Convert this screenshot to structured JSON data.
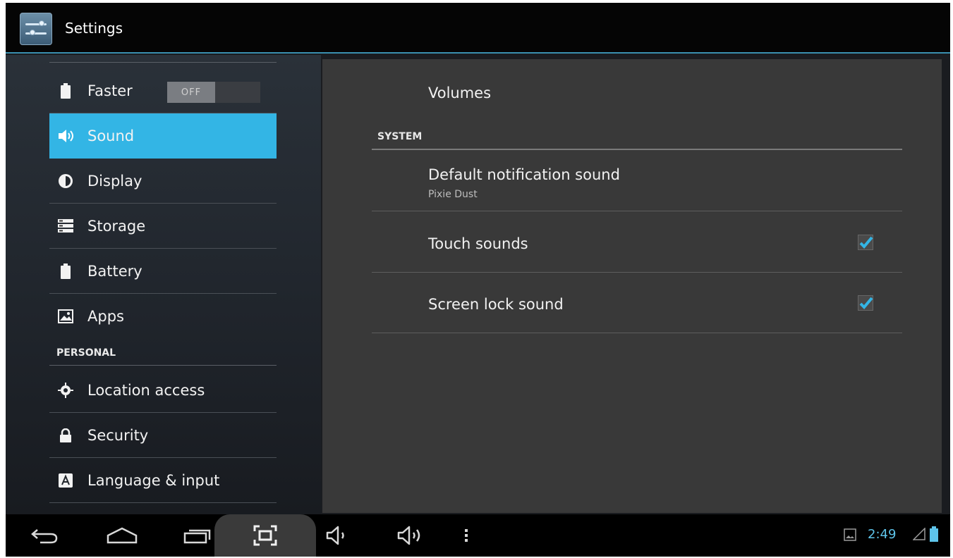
{
  "action_bar": {
    "title": "Settings",
    "icon": "settings-sliders-icon"
  },
  "sidebar": {
    "items": [
      {
        "id": "faster",
        "label": "Faster",
        "icon": "battery-icon",
        "toggle": "OFF"
      },
      {
        "id": "sound",
        "label": "Sound",
        "icon": "speaker-icon",
        "active": true
      },
      {
        "id": "display",
        "label": "Display",
        "icon": "brightness-icon"
      },
      {
        "id": "storage",
        "label": "Storage",
        "icon": "storage-icon"
      },
      {
        "id": "battery",
        "label": "Battery",
        "icon": "battery-icon"
      },
      {
        "id": "apps",
        "label": "Apps",
        "icon": "apps-icon"
      }
    ],
    "personal_header": "PERSONAL",
    "personal_items": [
      {
        "id": "location",
        "label": "Location access",
        "icon": "location-icon"
      },
      {
        "id": "security",
        "label": "Security",
        "icon": "lock-icon"
      },
      {
        "id": "language",
        "label": "Language & input",
        "icon": "keyboard-a-icon"
      }
    ]
  },
  "content": {
    "volumes": "Volumes",
    "system_header": "SYSTEM",
    "default_notification": {
      "title": "Default notification sound",
      "summary": "Pixie Dust"
    },
    "touch_sounds": {
      "title": "Touch sounds",
      "checked": true
    },
    "screen_lock_sound": {
      "title": "Screen lock sound",
      "checked": true
    }
  },
  "nav_bar": {
    "buttons": [
      "back-icon",
      "home-icon",
      "recent-apps-icon",
      "screenshot-icon",
      "volume-down-icon",
      "volume-up-icon",
      "overflow-menu-icon"
    ],
    "time": "2:49",
    "accent": "#33b5e5"
  }
}
